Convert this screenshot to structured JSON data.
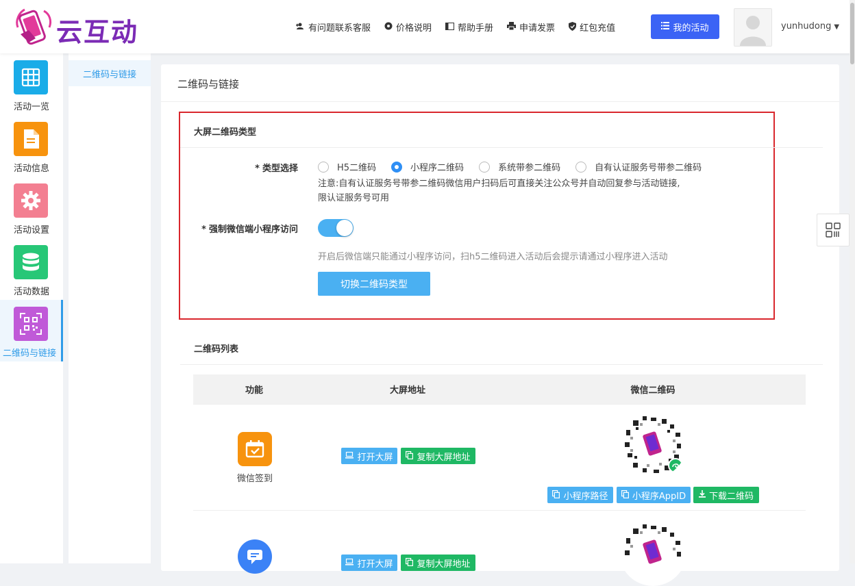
{
  "brand": {
    "logo_text": "云互动"
  },
  "header": {
    "nav": [
      {
        "label": "有问题联系客服",
        "icon": "user-plus-icon"
      },
      {
        "label": "价格说明",
        "icon": "gear-icon"
      },
      {
        "label": "帮助手册",
        "icon": "book-icon"
      },
      {
        "label": "申请发票",
        "icon": "printer-icon"
      },
      {
        "label": "红包充值",
        "icon": "shield-check-icon"
      }
    ],
    "primary_button": {
      "label": "我的活动",
      "icon": "list-icon"
    },
    "username": "yunhudong"
  },
  "sidebar": {
    "items": [
      {
        "label": "活动一览",
        "color": "#1aace8",
        "icon": "grid-icon"
      },
      {
        "label": "活动信息",
        "color": "#f7930e",
        "icon": "document-icon"
      },
      {
        "label": "活动设置",
        "color": "#f37f91",
        "icon": "gear-icon"
      },
      {
        "label": "活动数据",
        "color": "#27c777",
        "icon": "database-icon"
      },
      {
        "label": "二维码与链接",
        "color": "#c05ad8",
        "icon": "qrcode-icon"
      }
    ]
  },
  "submenu": {
    "items": [
      {
        "label": "二维码与链接"
      }
    ]
  },
  "main": {
    "title": "二维码与链接",
    "qr_type_section": {
      "title": "大屏二维码类型",
      "type_label": "类型选择",
      "required_mark": "*",
      "options": [
        {
          "label": "H5二维码",
          "checked": false
        },
        {
          "label": "小程序二维码",
          "checked": true
        },
        {
          "label": "系统带参二维码",
          "checked": false
        },
        {
          "label": "自有认证服务号带参二维码",
          "checked": false
        }
      ],
      "note_line1": "注意:自有认证服务号带参二维码微信用户扫码后可直接关注公众号并自动回复参与活动链接,",
      "note_line2": "限认证服务号可用",
      "force_label": "强制微信端小程序访问",
      "force_enabled": true,
      "hint": "开启后微信端只能通过小程序访问，扫h5二维码进入活动后会提示请通过小程序进入活动",
      "switch_button": "切换二维码类型"
    },
    "qr_list": {
      "title": "二维码列表",
      "columns": [
        "功能",
        "大屏地址",
        "微信二维码"
      ],
      "rows": [
        {
          "func": "微信签到",
          "func_color": "#f7930e",
          "func_icon": "calendar-check-icon",
          "open_screen": "打开大屏",
          "copy_screen": "复制大屏地址",
          "mp_path": "小程序路径",
          "mp_appid": "小程序AppID",
          "download": "下载二维码"
        },
        {
          "func": "",
          "func_color": "#3b82f6",
          "func_icon": "chat-icon",
          "open_screen": "打开大屏",
          "copy_screen": "复制大屏地址"
        }
      ]
    }
  }
}
